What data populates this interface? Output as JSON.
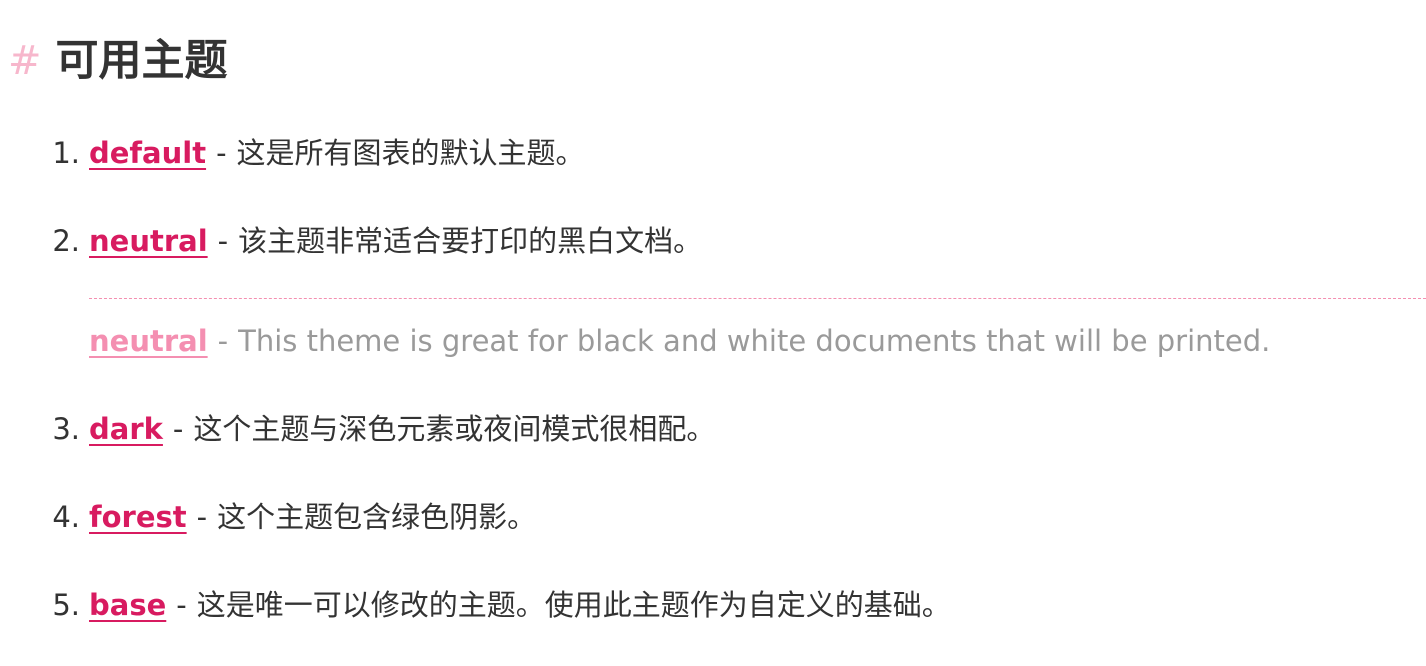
{
  "heading": {
    "hash": "#",
    "title": "可用主题"
  },
  "items": [
    {
      "num": "1.",
      "theme": "default",
      "sep": "-",
      "desc": "这是所有图表的默认主题。"
    },
    {
      "num": "2.",
      "theme": "neutral",
      "sep": "-",
      "desc": "该主题非常适合要打印的黑白文档。"
    },
    {
      "num": "3.",
      "theme": "dark",
      "sep": "-",
      "desc": "这个主题与深色元素或夜间模式很相配。"
    },
    {
      "num": "4.",
      "theme": "forest",
      "sep": "-",
      "desc": "这个主题包含绿色阴影。"
    },
    {
      "num": "5.",
      "theme": "base",
      "sep": "-",
      "desc": "这是唯一可以修改的主题。使用此主题作为自定义的基础。"
    }
  ],
  "translation": {
    "theme": "neutral",
    "sep": "-",
    "desc": "This theme is great for black and white documents that will be printed."
  },
  "colors": {
    "link": "#d81b60",
    "link_faded": "#f48fb1",
    "hash": "#f7b7cc",
    "text": "#333333",
    "translation_text": "#9a9a9a"
  }
}
